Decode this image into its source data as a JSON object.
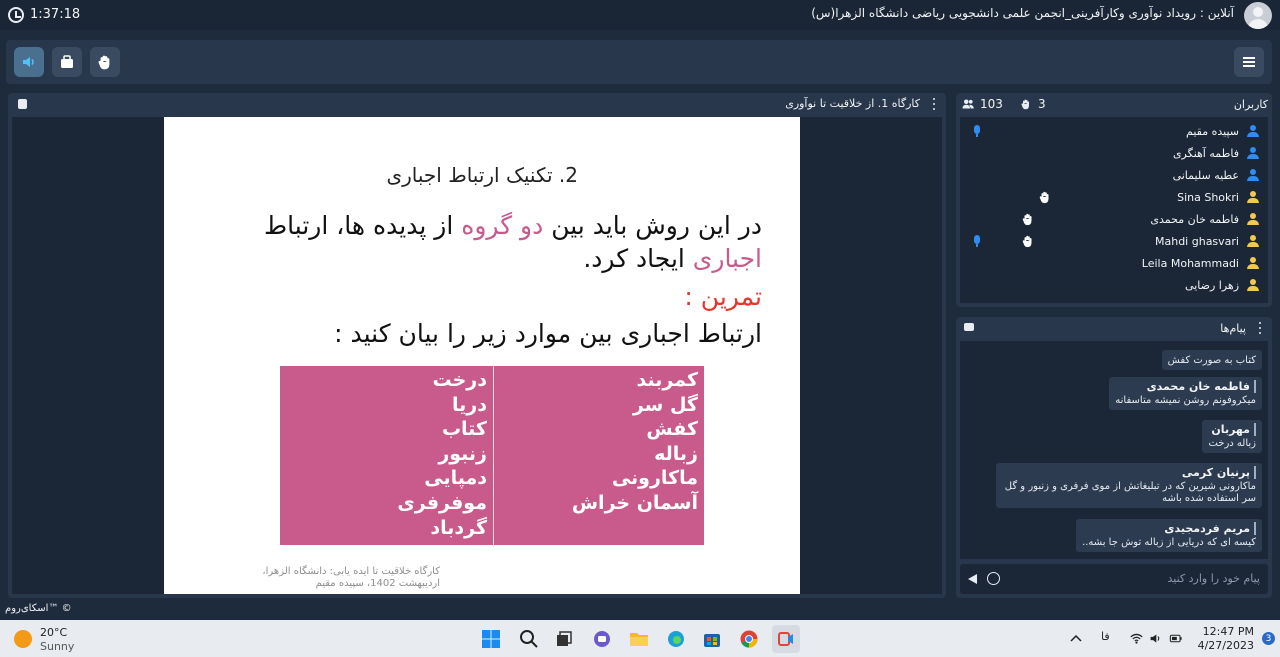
{
  "header": {
    "timer": "1:37:18",
    "room_title": "آنلاین : رویداد نوآوری وکارآفرینی_انجمن علمی دانشجویی ریاضی دانشگاه الزهرا(س)"
  },
  "toolbar": {
    "buttons": [
      "speaker-icon",
      "presentation-icon",
      "raise-hand-icon"
    ],
    "menu": "hamburger-menu-icon"
  },
  "presentation": {
    "title": "کارگاه 1. از خلاقیت تا نوآوری",
    "slide": {
      "heading": "2. تکنیک ارتباط اجباری",
      "p1_start": "در این روش باید بین ",
      "p1_hl1": "دو گروه",
      "p1_mid": " از پدیده ها، ارتباط ",
      "p1_hl2": "اجباری",
      "p1_end": " ایجاد کرد.",
      "exercise": "تمرین :",
      "p2": "ارتباط اجباری بین موارد زیر را بیان کنید :",
      "col1": [
        "درخت",
        "دریا",
        "کتاب",
        "زنبور",
        "دمپایی",
        "موفرفری",
        "گردباد"
      ],
      "col2": [
        "کمربند",
        "گل سر",
        "کفش",
        "زباله",
        "ماکارونی",
        "آسمان خراش"
      ],
      "footer_1": "کارگاه خلاقیت تا ایده یابی: دانشگاه الزهرا،",
      "footer_2": "اردیبهشت 1402، سپیده مقیم"
    }
  },
  "users": {
    "title": "کاربران",
    "hands_count": "3",
    "users_count": "103",
    "list": [
      {
        "name": "سپیده مقیم",
        "color": "#2f8cf0",
        "mic": true,
        "hand": false
      },
      {
        "name": "فاطمه آهنگری",
        "color": "#2f8cf0",
        "mic": false,
        "hand": false
      },
      {
        "name": "عطیه سلیمانی",
        "color": "#2f8cf0",
        "mic": false,
        "hand": false
      },
      {
        "name": "Sina Shokri",
        "color": "#f2c94c",
        "mic": false,
        "hand": true
      },
      {
        "name": "فاطمه خان محمدی",
        "color": "#f2c94c",
        "mic": false,
        "hand": true
      },
      {
        "name": "Mahdi ghasvari",
        "color": "#f2c94c",
        "mic": true,
        "hand": true
      },
      {
        "name": "Leila Mohammadi",
        "color": "#f2c94c",
        "mic": false,
        "hand": false
      },
      {
        "name": "زهرا رضایی",
        "color": "#f2c94c",
        "mic": false,
        "hand": false
      }
    ]
  },
  "messages": {
    "title": "پیام‌ها",
    "list": [
      {
        "name": "",
        "text": "کتاب به صورت کفش"
      },
      {
        "name": "فاطمه خان محمدی",
        "text": "میکروفونم روشن نمیشه متاسفانه"
      },
      {
        "name": "مهربان",
        "text": "زباله درخت"
      },
      {
        "name": "پرنیان کرمی",
        "text": "ماکارونی شیرین که در تبلیغاتش از موی فرفری و زنبور و گل سر استفاده شده باشه"
      },
      {
        "name": "مریم فردمجیدی",
        "text": "کیسه ای که دریایی از زباله توش جا بشه.."
      }
    ],
    "input_placeholder": "پیام خود را وارد کنید"
  },
  "brand": "اسکای‌روم™ ©",
  "taskbar": {
    "temperature": "20°C",
    "weather": "Sunny",
    "lang": "فا",
    "time": "12:47 PM",
    "date": "4/27/2023",
    "notifications": "3"
  },
  "colors": {
    "accent_pink": "#c85b8b",
    "exercise_red": "#e3362c",
    "panel_bg": "#28374b"
  }
}
